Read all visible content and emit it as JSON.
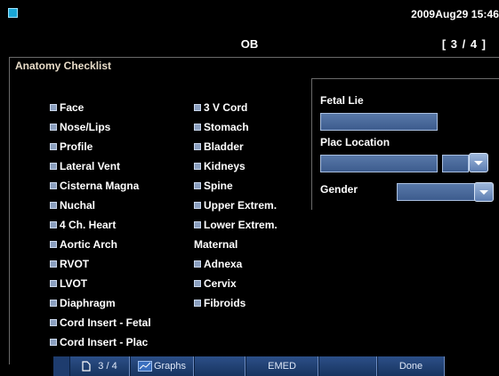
{
  "header": {
    "datetime": "2009Aug29  15:46",
    "title": "OB",
    "page_indicator": "[ 3 / 4 ]"
  },
  "panel": {
    "title": "Anatomy Checklist"
  },
  "checklist": {
    "left": [
      "Face",
      "Nose/Lips",
      "Profile",
      "Lateral Vent",
      "Cisterna Magna",
      "Nuchal",
      "4 Ch. Heart",
      "Aortic Arch",
      "RVOT",
      "LVOT",
      "Diaphragm",
      "Cord Insert - Fetal",
      "Cord Insert - Plac"
    ],
    "middle": [
      "3 V Cord",
      "Stomach",
      "Bladder",
      "Kidneys",
      "Spine",
      "Upper Extrem.",
      "Lower Extrem."
    ],
    "maternal_heading": "Maternal",
    "maternal": [
      "Adnexa",
      "Cervix",
      "Fibroids"
    ]
  },
  "fields": {
    "fetal_lie_label": "Fetal Lie",
    "plac_location_label": "Plac Location",
    "gender_label": "Gender"
  },
  "bottom": {
    "page": "3 / 4",
    "graphs": "Graphs",
    "emed": "EMED",
    "done": "Done"
  },
  "colors": {
    "field_fill": "#4a6a9c",
    "bottom_bar": "#1e3c6e",
    "checkbox": "#8a9fbf"
  }
}
